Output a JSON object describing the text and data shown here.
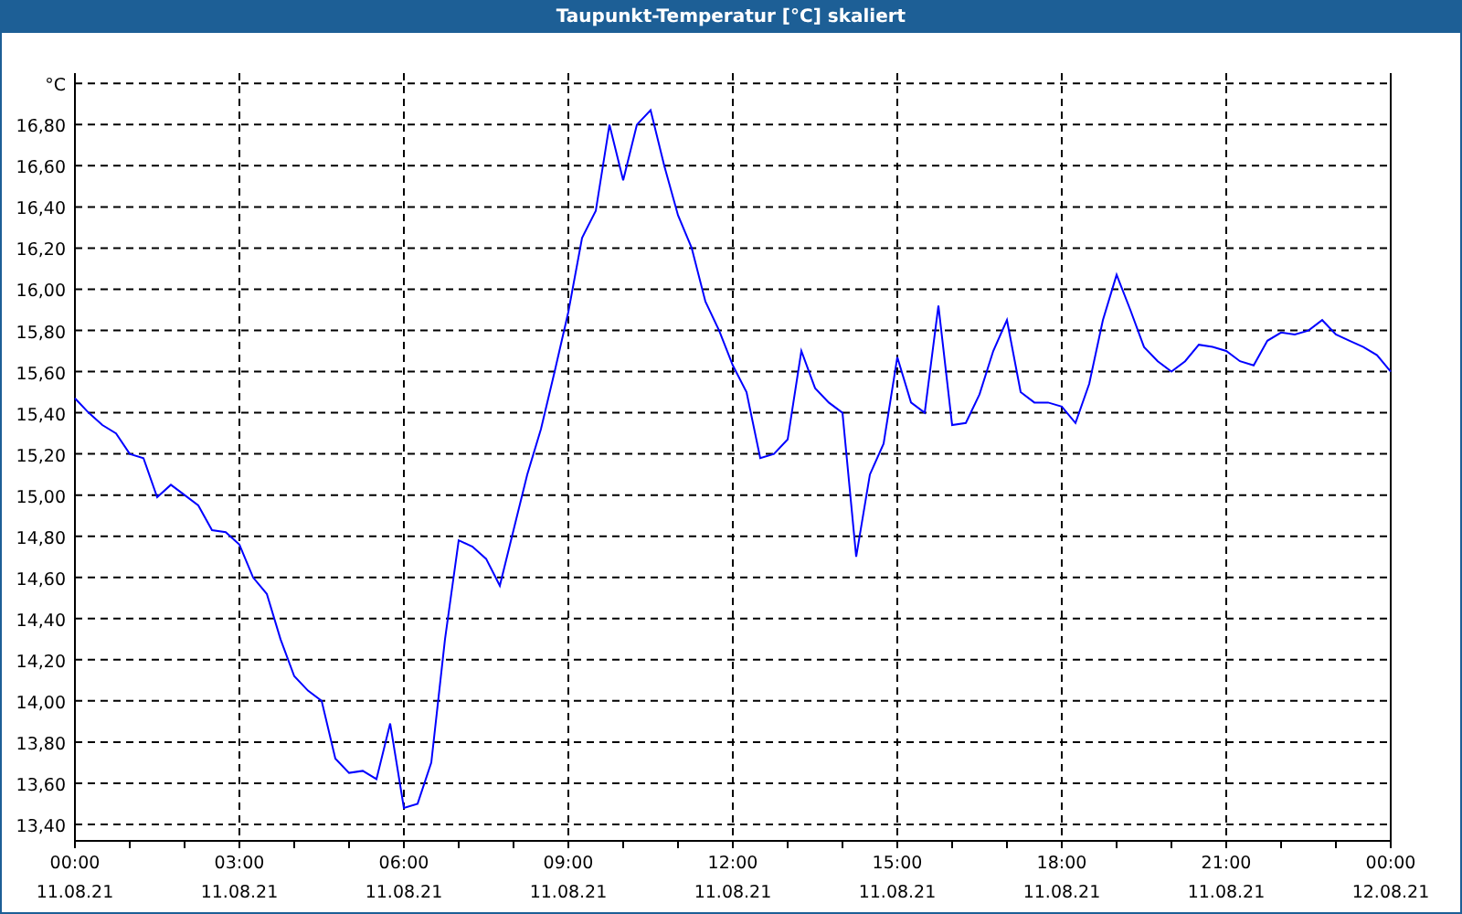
{
  "window": {
    "title": "Taupunkt-Temperatur [°C] skaliert"
  },
  "chart": {
    "chart_data": {
      "type": "line",
      "grid": true,
      "ylabel": "°C",
      "categories": [
        "00:00 11.08.21",
        null,
        null,
        null,
        null,
        null,
        null,
        null,
        null,
        null,
        null,
        null,
        "03:00 11.08.21",
        null,
        null,
        null,
        null,
        null,
        null,
        null,
        null,
        null,
        null,
        null,
        "06:00 11.08.21",
        null,
        null,
        null,
        null,
        null,
        null,
        null,
        null,
        null,
        null,
        null,
        "09:00 11.08.21",
        null,
        null,
        null,
        null,
        null,
        null,
        null,
        null,
        null,
        null,
        null,
        "12:00 11.08.21",
        null,
        null,
        null,
        null,
        null,
        null,
        null,
        null,
        null,
        null,
        null,
        "15:00 11.08.21",
        null,
        null,
        null,
        null,
        null,
        null,
        null,
        null,
        null,
        null,
        null,
        "18:00 11.08.21",
        null,
        null,
        null,
        null,
        null,
        null,
        null,
        null,
        null,
        null,
        null,
        "21:00 11.08.21",
        null,
        null,
        null,
        null,
        null,
        null,
        null,
        null,
        null,
        null,
        null,
        "00:00 12.08.21"
      ],
      "series": [
        {
          "color": "#0000ff",
          "values": [
            15.47,
            15.4,
            15.34,
            15.3,
            15.2,
            15.18,
            14.99,
            15.05,
            15.0,
            14.95,
            14.83,
            14.82,
            14.76,
            14.6,
            14.52,
            14.3,
            14.12,
            14.05,
            14.0,
            13.72,
            13.65,
            13.66,
            13.62,
            13.89,
            13.48,
            13.5,
            13.7,
            14.3,
            14.78,
            14.75,
            14.69,
            14.56,
            14.83,
            15.1,
            15.32,
            15.6,
            15.89,
            16.25,
            16.38,
            16.8,
            16.53,
            16.8,
            16.87,
            16.6,
            16.36,
            16.2,
            15.94,
            15.8,
            15.63,
            15.5,
            15.18,
            15.2,
            15.27,
            15.7,
            15.52,
            15.45,
            15.4,
            14.7,
            15.1,
            15.25,
            15.67,
            15.45,
            15.4,
            15.92,
            15.34,
            15.35,
            15.49,
            15.7,
            15.85,
            15.5,
            15.45,
            15.45,
            15.43,
            15.35,
            15.54,
            15.85,
            16.07,
            15.9,
            15.72,
            15.65,
            15.6,
            15.65,
            15.73,
            15.72,
            15.7,
            15.65,
            15.63,
            15.75,
            15.79,
            15.78,
            15.8,
            15.85,
            15.78,
            15.75,
            15.72,
            15.68,
            15.6
          ]
        }
      ],
      "ylim": [
        13.32,
        17.05
      ],
      "yticks": [
        {
          "value": 13.4,
          "label": "13,40"
        },
        {
          "value": 13.6,
          "label": "13,60"
        },
        {
          "value": 13.8,
          "label": "13,80"
        },
        {
          "value": 14.0,
          "label": "14,00"
        },
        {
          "value": 14.2,
          "label": "14,20"
        },
        {
          "value": 14.4,
          "label": "14,40"
        },
        {
          "value": 14.6,
          "label": "14,60"
        },
        {
          "value": 14.8,
          "label": "14,80"
        },
        {
          "value": 15.0,
          "label": "15,00"
        },
        {
          "value": 15.2,
          "label": "15,20"
        },
        {
          "value": 15.4,
          "label": "15,40"
        },
        {
          "value": 15.6,
          "label": "15,60"
        },
        {
          "value": 15.8,
          "label": "15,80"
        },
        {
          "value": 16.0,
          "label": "16,00"
        },
        {
          "value": 16.2,
          "label": "16,20"
        },
        {
          "value": 16.4,
          "label": "16,40"
        },
        {
          "value": 16.6,
          "label": "16,60"
        },
        {
          "value": 16.8,
          "label": "16,80"
        }
      ]
    }
  }
}
